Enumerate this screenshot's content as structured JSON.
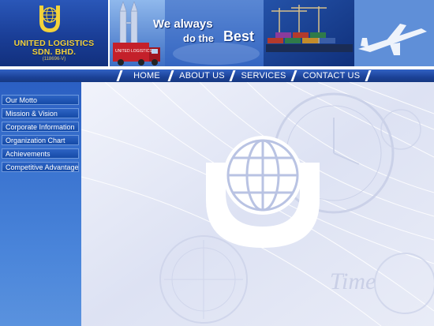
{
  "company": {
    "name_line1": "UNITED LOGISTICS",
    "name_line2": "SDN. BHD.",
    "registration": "(118696-V)",
    "truck_text": "UNITED LOGISTICS"
  },
  "banner": {
    "slogan_part1": "We always",
    "slogan_part2": "do the",
    "slogan_part3": "Best"
  },
  "nav": {
    "items": [
      {
        "label": "HOME"
      },
      {
        "label": "ABOUT US"
      },
      {
        "label": "SERVICES"
      },
      {
        "label": "CONTACT US"
      }
    ]
  },
  "sidebar": {
    "items": [
      {
        "label": "Our Motto"
      },
      {
        "label": "Mission & Vision"
      },
      {
        "label": "Corporate Information"
      },
      {
        "label": "Organization Chart"
      },
      {
        "label": "Achievements"
      },
      {
        "label": "Competitive Advantage"
      }
    ]
  },
  "main": {
    "watermark_text": "Time"
  },
  "colors": {
    "brand_blue": "#1c4298",
    "logo_gold": "#f3d23a",
    "sidebar_blue": "#3b74d0",
    "content_bg": "#e4e8f6"
  }
}
